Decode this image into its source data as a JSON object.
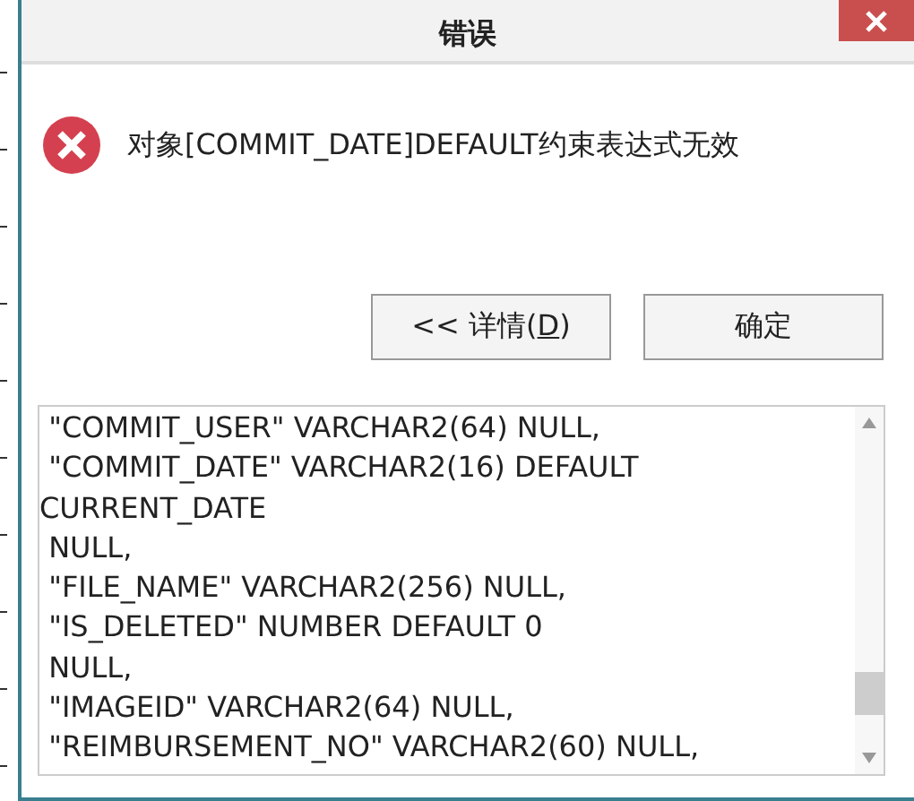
{
  "window": {
    "title": "错误"
  },
  "message": {
    "kind": "error",
    "text": "对象[COMMIT_DATE]DEFAULT约束表达式无效"
  },
  "buttons": [
    {
      "label_before": "<< 详情(",
      "mnemonic": "D",
      "label_after": ")"
    },
    {
      "label_before": "确定"
    }
  ],
  "details_lines": [
    " \"COMMIT_USER\" VARCHAR2(64) NULL,",
    " \"COMMIT_DATE\" VARCHAR2(16) DEFAULT",
    "CURRENT_DATE",
    " NULL,",
    " \"FILE_NAME\" VARCHAR2(256) NULL,",
    " \"IS_DELETED\" NUMBER DEFAULT 0",
    " NULL,",
    " \"IMAGEID\" VARCHAR2(64) NULL,",
    " \"REIMBURSEMENT_NO\" VARCHAR2(60) NULL,"
  ]
}
